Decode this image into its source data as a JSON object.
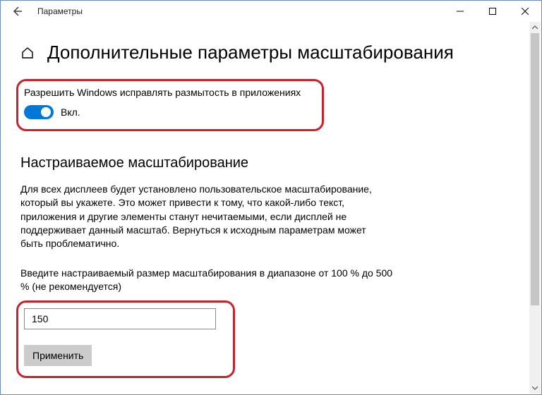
{
  "titlebar": {
    "title": "Параметры"
  },
  "page": {
    "heading": "Дополнительные параметры масштабирования"
  },
  "fixblur": {
    "label": "Разрешить Windows исправлять размытость в приложениях",
    "state": "Вкл."
  },
  "custom": {
    "heading": "Настраиваемое масштабирование",
    "description": "Для всех дисплеев будет установлено пользовательское масштабирование, который вы укажете. Это может привести к тому, что какой-либо текст, приложения и другие элементы станут нечитаемыми, если дисплей не поддерживает данный масштаб. Вернуться к исходным параметрам может быть проблематично.",
    "prompt": "Введите настраиваемый размер масштабирования в диапазоне от 100 % до 500 % (не рекомендуется)",
    "value": "150",
    "apply": "Применить"
  }
}
